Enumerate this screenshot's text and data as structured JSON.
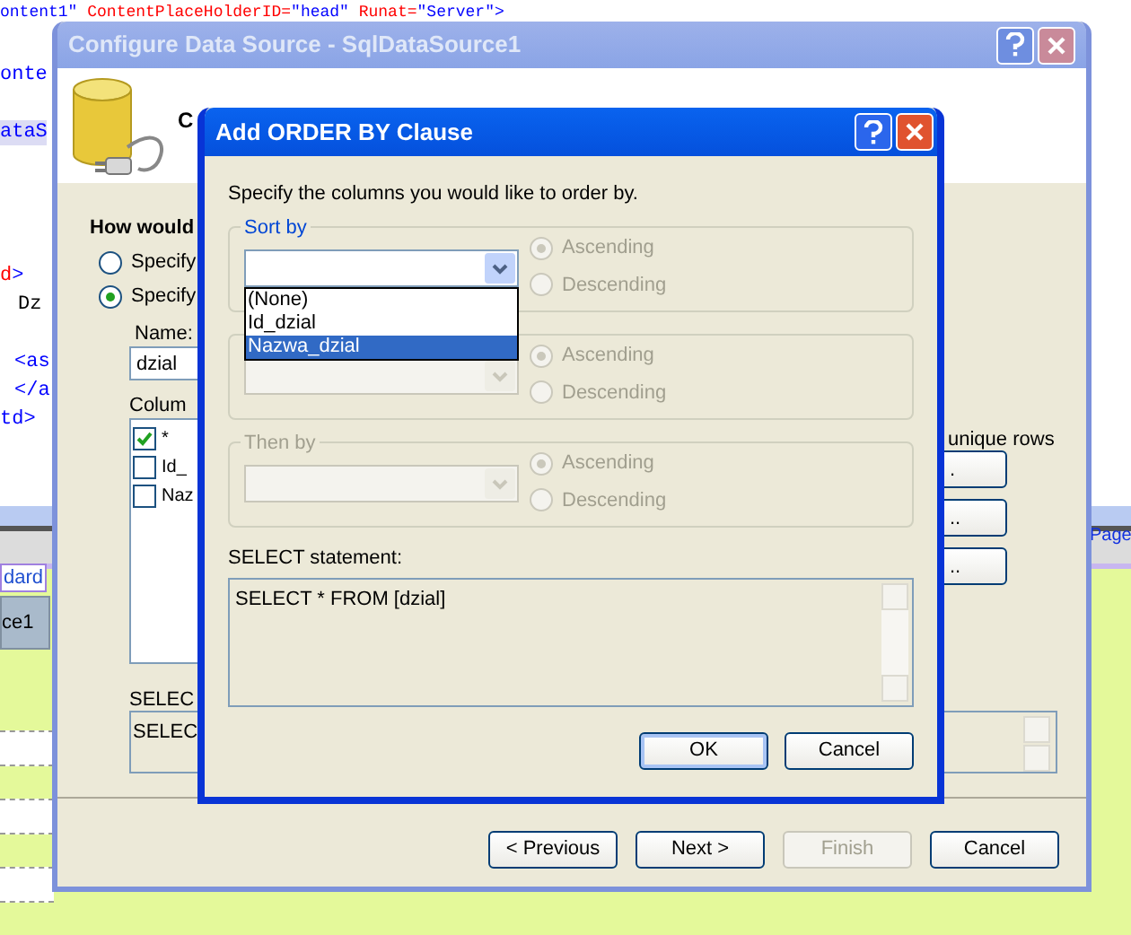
{
  "editor": {
    "lines": [
      {
        "kind": "header",
        "segments": [
          {
            "kind": "value",
            "text": "ontent1\""
          },
          {
            "kind": "attr",
            "text": " ContentPlaceHolderID="
          },
          {
            "kind": "value",
            "text": "\"head\""
          },
          {
            "kind": "attr",
            "text": " Runat="
          },
          {
            "kind": "value",
            "text": "\"Server\">"
          }
        ]
      },
      {
        "kind": "tag",
        "segments": [
          {
            "kind": "value",
            "text": "onte"
          }
        ]
      },
      {
        "kind": "highlight",
        "segments": [
          {
            "kind": "value",
            "text": "ataS"
          }
        ]
      },
      {
        "kind": "tag",
        "segments": [
          {
            "kind": "attr",
            "text": "d"
          },
          {
            "kind": "value",
            "text": ">"
          }
        ]
      },
      {
        "kind": "text",
        "segments": [
          {
            "kind": "plain",
            "text": "Dz"
          }
        ]
      },
      {
        "kind": "tag",
        "segments": [
          {
            "kind": "value",
            "text": "<as"
          }
        ]
      },
      {
        "kind": "tag",
        "segments": [
          {
            "kind": "value",
            "text": "</a"
          }
        ]
      },
      {
        "kind": "tag",
        "segments": [
          {
            "kind": "value",
            "text": "td>"
          }
        ]
      }
    ]
  },
  "designer": {
    "link": "dard",
    "control": "ce1",
    "page_link": "Page"
  },
  "main_window": {
    "title": "Configure Data Source - SqlDataSource1",
    "heading": "C",
    "question": "How would",
    "options": [
      {
        "label": "Specify",
        "selected": false
      },
      {
        "label": "Specify",
        "selected": true
      }
    ],
    "name_label": "Name:",
    "name_value": "dzial",
    "columns_label": "Colum",
    "columns": [
      {
        "label": "*",
        "checked": true
      },
      {
        "label": "Id_",
        "checked": false
      },
      {
        "label": "Naz",
        "checked": false
      }
    ],
    "unique_rows": "unique rows",
    "side_buttons": [
      {
        "label": "."
      },
      {
        "label": ".."
      },
      {
        "label": ".."
      }
    ],
    "select_label": "SELEC",
    "select_value": "SELEC",
    "buttons": [
      {
        "label": "< Previous",
        "disabled": false
      },
      {
        "label": "Next >",
        "disabled": false
      },
      {
        "label": "Finish",
        "disabled": true
      },
      {
        "label": "Cancel",
        "disabled": false
      }
    ]
  },
  "dialog": {
    "title": "Add ORDER BY Clause",
    "instruction": "Specify the columns you would like to order by.",
    "groups": [
      {
        "label": "Sort by",
        "disabled": false,
        "ascending": "Ascending",
        "descending": "Descending",
        "ascending_selected": true
      },
      {
        "disabled": true,
        "ascending": "Ascending",
        "descending": "Descending",
        "ascending_selected": true
      },
      {
        "label": "Then by",
        "disabled": true,
        "ascending": "Ascending",
        "descending": "Descending",
        "ascending_selected": true
      }
    ],
    "dropdown": [
      {
        "label": "(None)",
        "selected": false
      },
      {
        "label": "Id_dzial",
        "selected": false
      },
      {
        "label": "Nazwa_dzial",
        "selected": true
      }
    ],
    "select_label": "SELECT statement:",
    "select_value": "SELECT * FROM [dzial]",
    "buttons": [
      {
        "label": "OK",
        "default": true
      },
      {
        "label": "Cancel",
        "default": false
      }
    ]
  }
}
